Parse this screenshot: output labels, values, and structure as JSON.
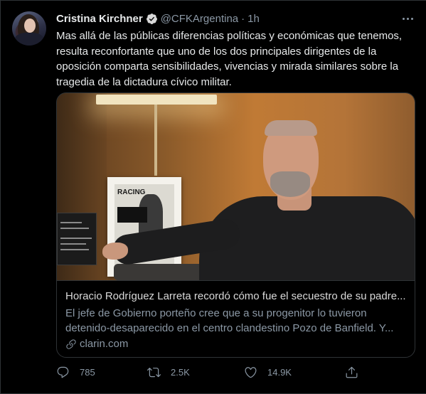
{
  "tweet": {
    "author_name": "Cristina Kirchner",
    "handle": "@CFKArgentina",
    "separator": "·",
    "time": "1h",
    "text": "Mas allá de las públicas diferencias políticas y económicas que tenemos, resulta reconfortante que uno de los dos principales dirigentes de la oposición comparta sensibilidades, vivencias y mirada similares sobre la tragedia de la dictadura cívico militar.",
    "card": {
      "frame_text": "RACING",
      "title": "Horacio Rodríguez Larreta recordó cómo fue el secuestro de su padre...",
      "description": "El jefe de Gobierno porteño cree que a su progenitor lo tuvieron detenido-desaparecido en el centro clandestino Pozo de Banfield. Y...",
      "domain": "clarin.com"
    },
    "actions": {
      "replies": "785",
      "retweets": "2.5K",
      "likes": "14.9K"
    }
  },
  "icons": [
    "verified-badge-icon",
    "more-options-icon",
    "link-icon",
    "reply-icon",
    "retweet-icon",
    "like-icon",
    "share-icon"
  ],
  "colors": {
    "background": "#000000",
    "verified": "#1d9bf0",
    "text_primary": "#e7e9ea",
    "text_secondary": "#8b98a5",
    "border": "#2f3336"
  }
}
